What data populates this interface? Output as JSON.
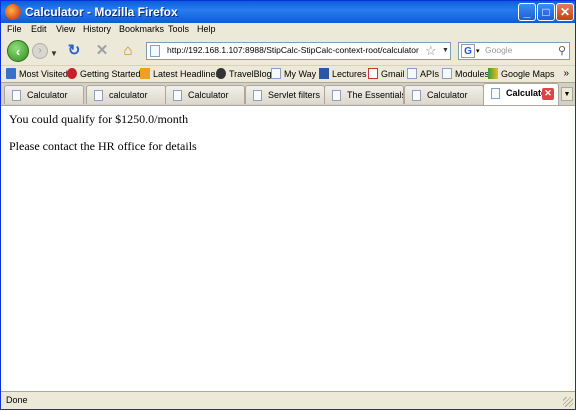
{
  "window": {
    "title": "Calculator - Mozilla Firefox"
  },
  "menu": [
    "File",
    "Edit",
    "View",
    "History",
    "Bookmarks",
    "Tools",
    "Help"
  ],
  "nav": {
    "url": "http://192.168.1.107:8988/StipCalc-StipCalc-context-root/calculator",
    "search_placeholder": "Google",
    "search_engine_icon": "G"
  },
  "bookmarks": [
    "Most Visited",
    "Getting Started",
    "Latest Headlines",
    "TravelBlog",
    "My Way",
    "Lectures",
    "Gmail",
    "APIs",
    "Modules",
    "Google Maps"
  ],
  "bookmarks_overflow": "»",
  "tabs": [
    "Calculator",
    "calculator",
    "Calculator",
    "Servlet filters",
    "The Essentials...",
    "Calculator",
    "Calculator"
  ],
  "content": {
    "line1": "You could qualify for $1250.0/month",
    "line2": "Please contact the HR office for details"
  },
  "status": "Done"
}
